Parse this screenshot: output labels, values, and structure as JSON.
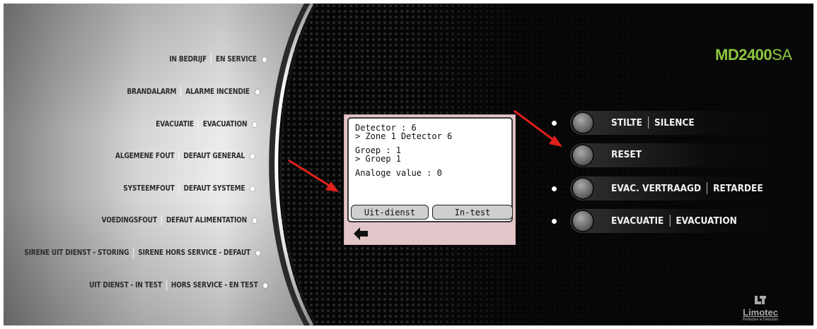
{
  "model": {
    "bold": "MD2400",
    "light": "SA"
  },
  "indicators": [
    {
      "nl": "IN BEDRIJF",
      "fr": "EN SERVICE"
    },
    {
      "nl": "BRANDALARM",
      "fr": "ALARME INCENDIE"
    },
    {
      "nl": "EVACUATIE",
      "fr": "EVACUATION"
    },
    {
      "nl": "ALGEMENE FOUT",
      "fr": "DEFAUT GENERAL"
    },
    {
      "nl": "SYSTEEMFOUT",
      "fr": "DEFAUT SYSTEME"
    },
    {
      "nl": "VOEDINGSFOUT",
      "fr": "DEFAUT ALIMENTATION"
    },
    {
      "nl": "SIRENE UIT DIENST - STORING",
      "fr": "SIRENE HORS SERVICE - DEFAUT"
    },
    {
      "nl": "UIT DIENST - IN TEST",
      "fr": "HORS SERVICE - EN TEST"
    }
  ],
  "controls": [
    {
      "nl": "STILTE",
      "fr": "SILENCE"
    },
    {
      "nl": "RESET",
      "fr": ""
    },
    {
      "nl": "EVAC. VERTRAAGD",
      "fr": "RETARDEE"
    },
    {
      "nl": "EVACUATIE",
      "fr": "EVACUATION"
    }
  ],
  "lcd": {
    "lines": [
      "Detector : 6",
      "> Zone 1 Detector 6",
      "Groep : 1",
      "> Groep 1",
      "Analoge value : 0"
    ],
    "buttons": {
      "out_of_service": "Uit-dienst",
      "in_test": "In-test"
    },
    "back_icon": "back-arrow-icon"
  },
  "brand": {
    "name": "Limotec",
    "tagline": "Perfection in Detection",
    "icon": "limotec-logo-icon"
  },
  "colors": {
    "model": "#8cc63f",
    "annotation_arrow": "#e0201c",
    "lcd_frame": "#e3c6c9"
  }
}
